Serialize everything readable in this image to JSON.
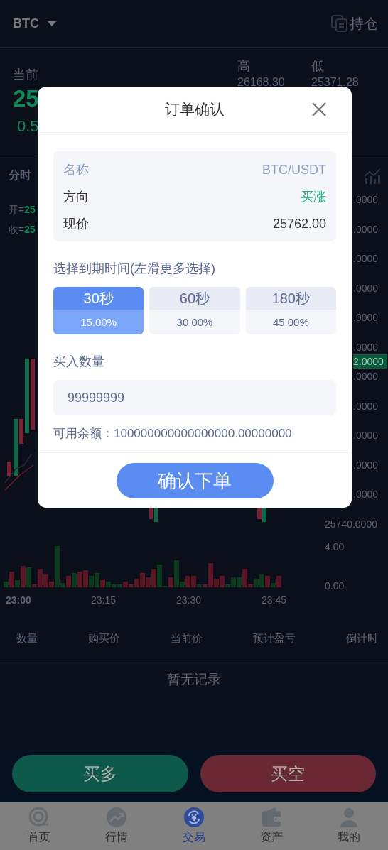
{
  "header": {
    "symbol": "BTC",
    "positions_label": "持仓"
  },
  "ticker": {
    "current_label": "当前",
    "price": "25",
    "change": "0.5",
    "high_label": "高",
    "high": "26168.30",
    "low_label": "低",
    "low": "25371.28"
  },
  "chart": {
    "tab": "分时",
    "open_label": "开=",
    "open": "25",
    "close_label": "收=",
    "close": "25",
    "price_axis": [
      ".0000",
      ".0000",
      ".0000",
      ".0000",
      ".0000",
      ".0000",
      ".0000",
      ".0000",
      ".0000",
      ".0000",
      ".0000",
      "25740.0000"
    ],
    "current_price_tag": "2.0000",
    "volume_axis": [
      "4.00",
      "0.00"
    ],
    "times": [
      "23:00",
      "23:15",
      "23:30",
      "23:45"
    ]
  },
  "orders_table": {
    "columns": [
      "数量",
      "购买价",
      "当前价",
      "预计盈亏",
      "倒计时"
    ],
    "empty": "暂无记录"
  },
  "actions": [
    {
      "label": "买多",
      "kind": "long"
    },
    {
      "label": "买空",
      "kind": "short"
    }
  ],
  "nav": [
    {
      "label": "首页",
      "selected": false
    },
    {
      "label": "行情",
      "selected": false
    },
    {
      "label": "交易",
      "selected": true
    },
    {
      "label": "资产",
      "selected": false
    },
    {
      "label": "我的",
      "selected": false
    }
  ],
  "dialog": {
    "title": "订单确认",
    "summary": [
      {
        "label": "名称",
        "value": "BTC/USDT",
        "kind": "muted"
      },
      {
        "label": "方向",
        "value": "买涨",
        "kind": "up"
      },
      {
        "label": "现价",
        "value": "25762.00",
        "kind": "plain"
      }
    ],
    "expiry_label": "选择到期时间(左滑更多选择)",
    "expiry_options": [
      {
        "time": "30秒",
        "rate": "15.00%",
        "selected": true
      },
      {
        "time": "60秒",
        "rate": "30.00%",
        "selected": false
      },
      {
        "time": "180秒",
        "rate": "45.00%",
        "selected": false
      }
    ],
    "amount_label": "买入数量",
    "amount": "99999999",
    "balance": "可用余额：100000000000000000.00000000",
    "confirm": "确认下单"
  }
}
